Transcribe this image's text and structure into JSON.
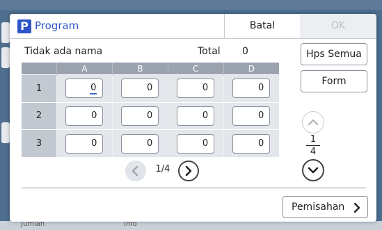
{
  "dialog": {
    "title": "Program",
    "title_badge": "P",
    "cancel_label": "Batal",
    "ok_label": "OK",
    "accent_color": "#2e55c9"
  },
  "program": {
    "name": "Tidak ada nama",
    "total_label": "Total",
    "total_value": "0"
  },
  "grid": {
    "columns": [
      "A",
      "B",
      "C",
      "D"
    ],
    "rows": [
      {
        "label": "1",
        "values": [
          "0",
          "0",
          "0",
          "0"
        ]
      },
      {
        "label": "2",
        "values": [
          "0",
          "0",
          "0",
          "0"
        ]
      },
      {
        "label": "3",
        "values": [
          "0",
          "0",
          "0",
          "0"
        ]
      }
    ]
  },
  "pager": {
    "text": "1/4",
    "prev_icon": "chevron-left-icon",
    "next_icon": "chevron-right-icon"
  },
  "side": {
    "clear_all_label": "Hps Semua",
    "form_label": "Form",
    "page_current": "1",
    "page_total": "4"
  },
  "footer": {
    "separator_label": "Pemisahan"
  },
  "background": {
    "left_text": "Jumlah",
    "mid_text": "Info"
  }
}
